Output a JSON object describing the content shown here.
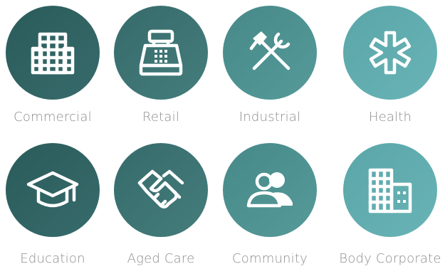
{
  "sectors": [
    {
      "label": "Commercial",
      "icon": "office-building-icon",
      "color": "#2f6060"
    },
    {
      "label": "Retail",
      "icon": "cash-register-icon",
      "color": "#3c7575"
    },
    {
      "label": "Industrial",
      "icon": "hammer-wrench-icon",
      "color": "#4e9191"
    },
    {
      "label": "Health",
      "icon": "star-of-life-icon",
      "color": "#63adb0"
    },
    {
      "label": "Education",
      "icon": "graduation-cap-icon",
      "color": "#2f6060"
    },
    {
      "label": "Aged Care",
      "icon": "handshake-icon",
      "color": "#3c7575"
    },
    {
      "label": "Community",
      "icon": "people-icon",
      "color": "#4e9191"
    },
    {
      "label": "Body Corporate",
      "icon": "apartment-building-icon",
      "color": "#63adb0"
    }
  ]
}
